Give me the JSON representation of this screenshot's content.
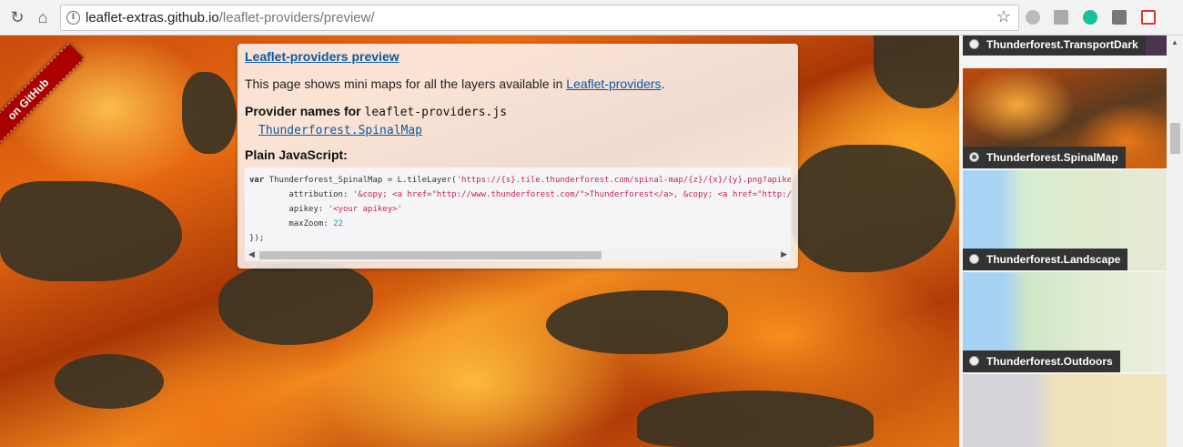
{
  "browser": {
    "url_host": "leaflet-extras.github.io",
    "url_path": "/leaflet-providers/preview/",
    "icons": [
      "back-icon",
      "forward-icon",
      "reload-icon",
      "home-icon",
      "info-icon",
      "star-icon"
    ]
  },
  "ribbon": {
    "label": "on GitHub"
  },
  "panel": {
    "title": "Leaflet-providers preview",
    "intro_text": "This page shows mini maps for all the layers available in",
    "intro_link": "Leaflet-providers",
    "intro_end": ".",
    "provider_heading": "Provider names for",
    "provider_file": "leaflet-providers.js",
    "provider_name": "Thunderforest.SpinalMap",
    "js_heading": "Plain JavaScript:",
    "code": {
      "line1_kw": "var",
      "line1_var": " Thunderforest_SpinalMap = L.tileLayer(",
      "line1_str": "'https://{s}.tile.thunderforest.com/spinal-map/{z}/{x}/{y}.png?apikey={apikey}'",
      "line2_key": "        attribution: ",
      "line2_str": "'&copy; <a href=\"http://www.thunderforest.com/\">Thunderforest</a>, &copy; <a href=\"http://www.openstreetmap.org/copyright\">OpenStreetMap</a>'",
      "line3_key": "        apikey: ",
      "line3_str": "'<your apikey>'",
      "line4_key": "        maxZoom: ",
      "line4_num": "22",
      "line5": "});"
    }
  },
  "sidebar": {
    "layers": [
      {
        "label": "Thunderforest.TransportDark",
        "checked": false
      },
      {
        "label": "Thunderforest.SpinalMap",
        "checked": true
      },
      {
        "label": "Thunderforest.Landscape",
        "checked": false
      },
      {
        "label": "Thunderforest.Outdoors",
        "checked": false
      }
    ]
  }
}
